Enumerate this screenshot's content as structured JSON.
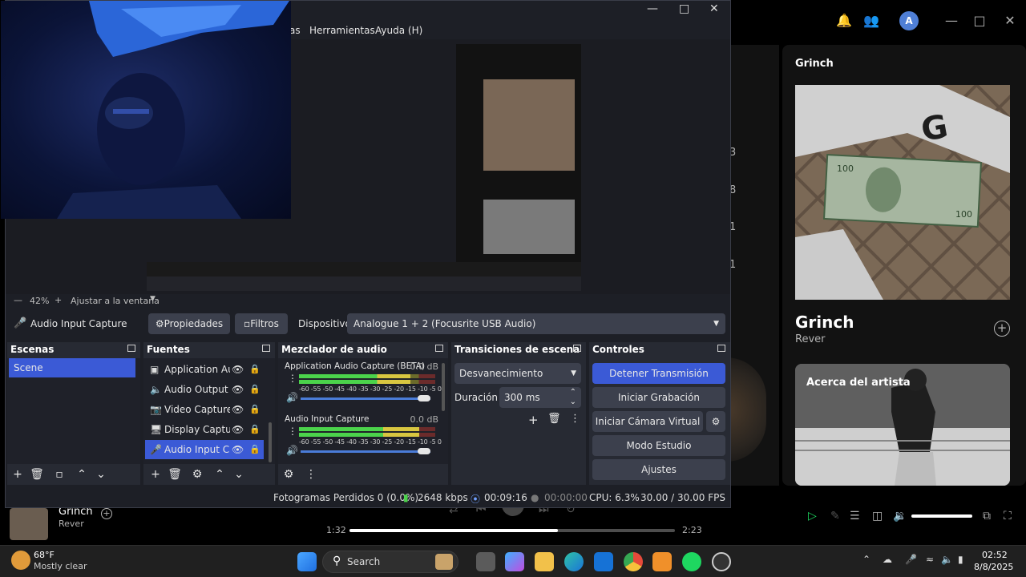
{
  "obs": {
    "menu": [
      "as",
      "Herramientas",
      "Ayuda (H)"
    ],
    "zoom": {
      "level": "42%",
      "fit_label": "Ajustar a la ventana"
    },
    "source_toolbar": {
      "selected_source": "Audio Input Capture",
      "properties_label": "Propiedades",
      "filters_label": "Filtros",
      "device_label": "Dispositivo",
      "device_value": "Analogue 1 + 2 (Focusrite USB Audio)"
    },
    "docks": {
      "scenes": {
        "title": "Escenas",
        "items": [
          "Scene"
        ]
      },
      "sources": {
        "title": "Fuentes",
        "items": [
          "Application Aud",
          "Audio Output C",
          "Video Capture D",
          "Display Capture",
          "Audio Input Cap"
        ]
      },
      "mixer": {
        "title": "Mezclador de audio",
        "tracks": [
          {
            "name": "Application Audio Capture (BETA)",
            "db": "0.0 dB",
            "level": 0.82,
            "volume": 1.0
          },
          {
            "name": "Audio Input Capture",
            "db": "0.0 dB",
            "level": 0.88,
            "volume": 1.0
          }
        ],
        "scale": "-60 -55 -50 -45 -40 -35 -30 -25 -20 -15 -10 -5 0"
      },
      "transitions": {
        "title": "Transiciones de escena",
        "transition": "Desvanecimiento",
        "duration_label": "Duración",
        "duration_value": "300 ms"
      },
      "controls": {
        "title": "Controles",
        "stop_stream": "Detener Transmisión",
        "start_record": "Iniciar Grabación",
        "virtual_cam": "Iniciar Cámara Virtual",
        "studio_mode": "Modo Estudio",
        "settings": "Ajustes"
      }
    },
    "status": {
      "dropped_frames": "Fotogramas Perdidos 0 (0.0%)",
      "bitrate": "2648 kbps",
      "stream_time": "00:09:16",
      "record_time": "00:00:00",
      "cpu": "CPU: 6.3%",
      "fps": "30.00 / 30.00 FPS"
    }
  },
  "spotify": {
    "avatar_letter": "A",
    "panel_title": "Grinch",
    "track_title": "Grinch",
    "artist": "Rever",
    "about_artist": "Acerca del artista",
    "list_numbers": [
      "3",
      "8",
      "1",
      "1"
    ],
    "player": {
      "track": "Grinch",
      "artist": "Rever",
      "current_time": "1:32",
      "total_time": "2:23",
      "progress": 0.64,
      "volume": 1.0
    }
  },
  "taskbar": {
    "weather_temp": "68°F",
    "weather_desc": "Mostly clear",
    "search_label": "Search",
    "time": "02:52",
    "date": "8/8/2025"
  },
  "colors": {
    "obs_bg": "#1d1f26",
    "obs_accent": "#3b5ad6",
    "spotify_green": "#1ed760"
  }
}
